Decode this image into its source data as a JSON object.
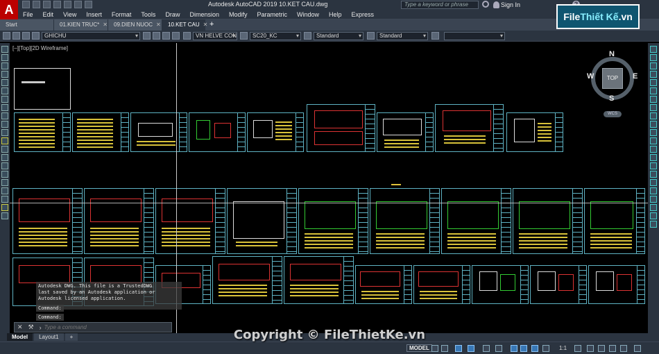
{
  "app": {
    "logo_letter": "A",
    "title": "Autodesk AutoCAD 2019    10.KET CAU.dwg",
    "search_placeholder": "Type a keyword or phrase",
    "sign_in": "Sign In",
    "help": "?"
  },
  "menu": [
    "File",
    "Edit",
    "View",
    "Insert",
    "Format",
    "Tools",
    "Draw",
    "Dimension",
    "Modify",
    "Parametric",
    "Window",
    "Help",
    "Express"
  ],
  "brand_logo": {
    "part1": "File ",
    "part2": "Thiết Kế",
    "part3": ".vn"
  },
  "file_tabs": [
    {
      "label": "Start",
      "active": false
    },
    {
      "label": "01.KIEN TRUC*",
      "active": false
    },
    {
      "label": "09.DIEN NUOC",
      "active": false
    },
    {
      "label": "10.KET CAU",
      "active": true
    }
  ],
  "properties": {
    "layer": "GHICHU",
    "text_style": "VN HELVE CON",
    "dim_style": "SC20_KC",
    "table_style": "Standard",
    "mleader_style": "Standard",
    "extra": ""
  },
  "viewport_label": "[–][Top][2D Wireframe]",
  "viewcube": {
    "north": "N",
    "south": "S",
    "east": "E",
    "west": "W",
    "face": "TOP",
    "wcs": "WCS"
  },
  "command": {
    "history": [
      "Autodesk DWG.  This file is a TrustedDWG",
      "last saved by an Autodesk application or",
      "Autodesk licensed application."
    ],
    "prompt_1": "Command:",
    "prompt_2": "Command:",
    "input_placeholder": "Type a command"
  },
  "layout_tabs": [
    "Model",
    "Layout1"
  ],
  "status": {
    "model": "MODEL",
    "scale": "1:1"
  },
  "watermark": "Copyright © FileThietKe.vn",
  "colors": {
    "background": "#000000",
    "sheet_border": "#5fb3c4",
    "accent": "#b00000"
  }
}
